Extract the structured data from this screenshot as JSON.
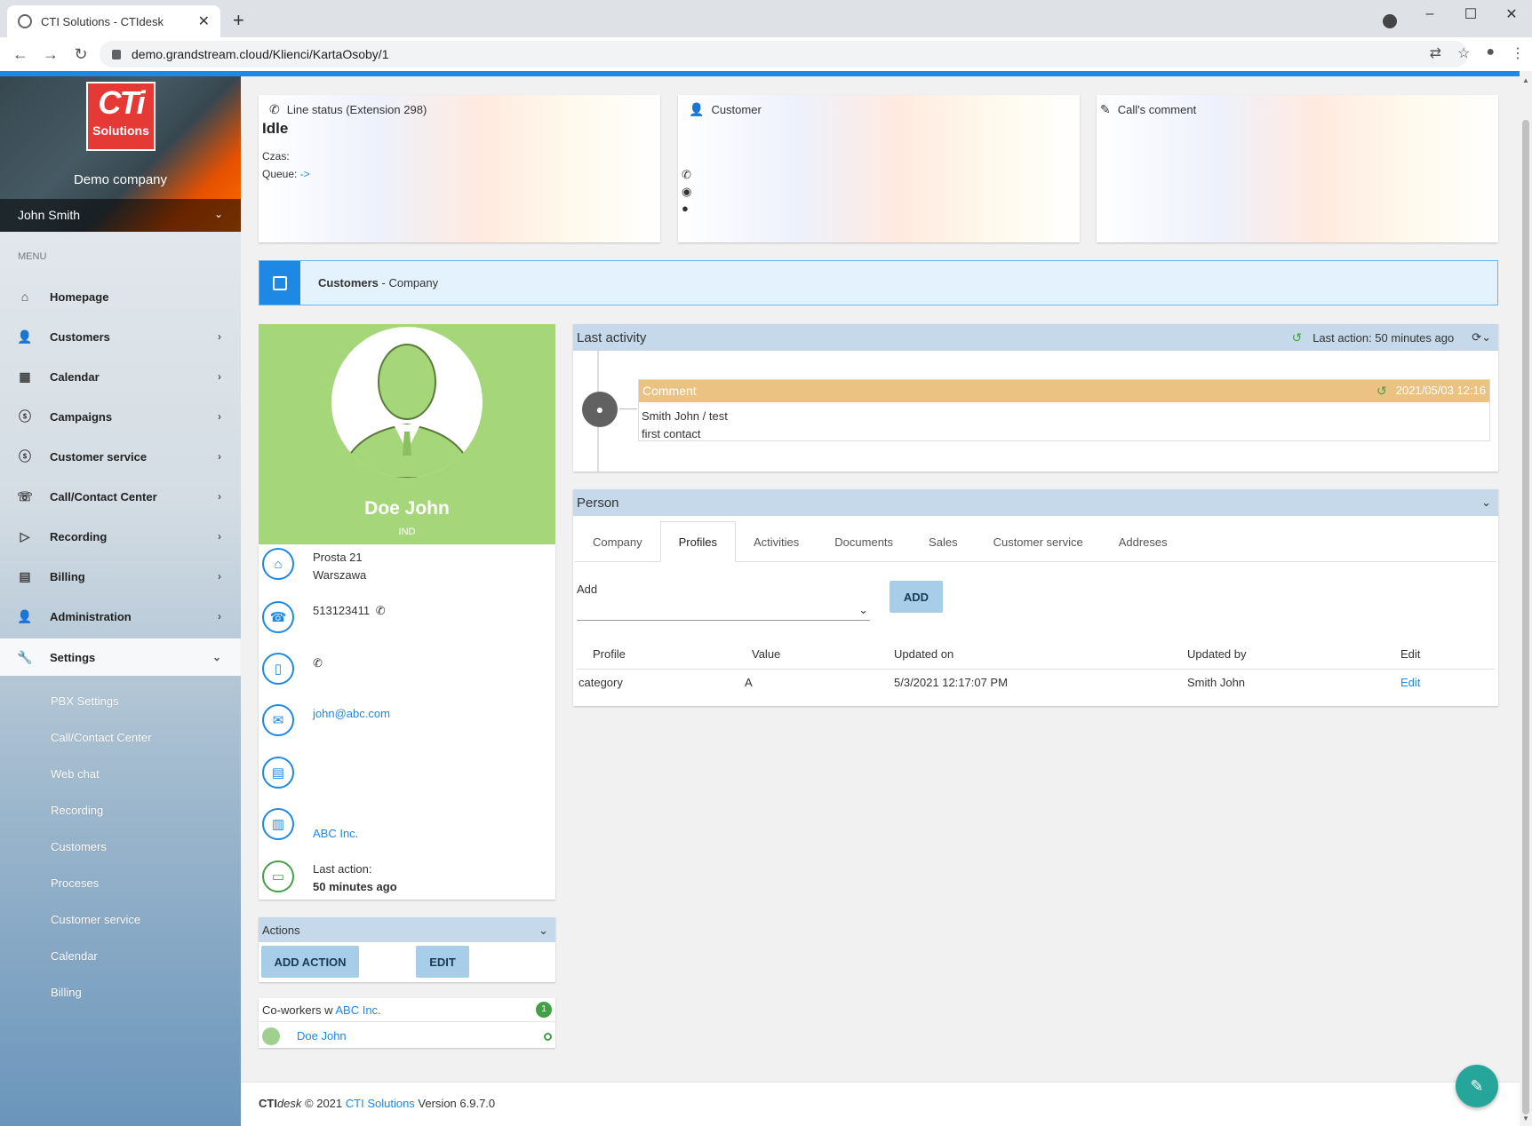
{
  "browser": {
    "tab_title": "CTI Solutions - CTIdesk",
    "url": "demo.grandstream.cloud/Klienci/KartaOsoby/1"
  },
  "sidebar": {
    "logo_top": "CTi",
    "logo_bottom": "Solutions",
    "company": "Demo company",
    "user": "John Smith",
    "menu_label": "MENU",
    "items": [
      {
        "label": "Homepage",
        "icon": "home-icon"
      },
      {
        "label": "Customers",
        "icon": "user-icon"
      },
      {
        "label": "Calendar",
        "icon": "calendar-icon"
      },
      {
        "label": "Campaigns",
        "icon": "dollar-icon"
      },
      {
        "label": "Customer service",
        "icon": "dollar-icon"
      },
      {
        "label": "Call/Contact Center",
        "icon": "phone-icon"
      },
      {
        "label": "Recording",
        "icon": "play-icon"
      },
      {
        "label": "Billing",
        "icon": "cash-icon"
      },
      {
        "label": "Administration",
        "icon": "admin-icon"
      },
      {
        "label": "Settings",
        "icon": "wrench-icon"
      }
    ],
    "settings_sub": [
      "PBX Settings",
      "Call/Contact Center",
      "Web chat",
      "Recording",
      "Customers",
      "Proceses",
      "Customer service",
      "Calendar",
      "Billing"
    ]
  },
  "status": {
    "line_title": "Line status (Extension 298)",
    "line_state": "Idle",
    "time_label": "Czas:",
    "queue_label": "Queue:",
    "queue_value": "->",
    "customer_title": "Customer",
    "comment_title": "Call's comment"
  },
  "breadcrumb": {
    "section": "Customers",
    "separator": " - ",
    "page": "Company"
  },
  "profile": {
    "name": "Doe John",
    "type": "IND",
    "street": "Prosta 21",
    "city": "Warszawa",
    "phone": "513123411",
    "email": "john@abc.com",
    "company": "ABC Inc.",
    "last_action_label": "Last action:",
    "last_action_value": "50 minutes ago"
  },
  "actions": {
    "title": "Actions",
    "add_action": "ADD ACTION",
    "edit": "EDIT"
  },
  "coworkers": {
    "label": "Co-workers w ",
    "company": "ABC Inc.",
    "count": "1",
    "items": [
      "Doe John"
    ]
  },
  "last_activity": {
    "title": "Last activity",
    "last_action": "Last action: 50 minutes ago",
    "comment_title": "Comment",
    "comment_date": "2021/05/03 12:16",
    "comment_line1": "Smith John / test",
    "comment_line2": "first contact"
  },
  "person": {
    "title": "Person",
    "tabs": [
      "Company",
      "Profiles",
      "Activities",
      "Documents",
      "Sales",
      "Customer service",
      "Addreses"
    ],
    "active_tab": "Profiles",
    "add_label": "Add",
    "add_button": "ADD",
    "table": {
      "headers": [
        "Profile",
        "Value",
        "Updated on",
        "Updated by",
        "Edit"
      ],
      "rows": [
        [
          "category",
          "A",
          "5/3/2021 12:17:07 PM",
          "Smith John",
          "Edit"
        ]
      ]
    }
  },
  "footer": {
    "brand": "CTI",
    "brand_italic": "desk",
    "copy": " © 2021 ",
    "company": "CTI Solutions",
    "version": " Version 6.9.7.0"
  },
  "colors": {
    "accent": "#1e88e5",
    "profile_green": "#a5d67a",
    "comment_header": "#ecc283",
    "fab": "#26a69a"
  }
}
